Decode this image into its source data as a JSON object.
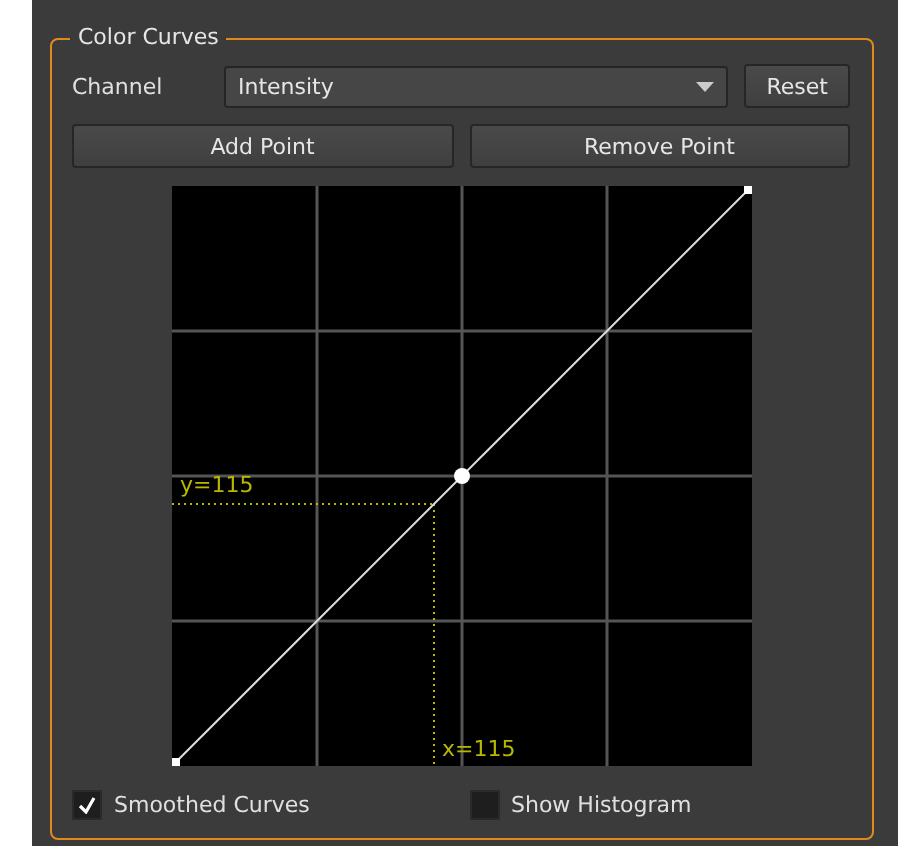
{
  "group": {
    "title": "Color Curves"
  },
  "channel": {
    "label": "Channel",
    "value": "Intensity"
  },
  "reset_button": "Reset",
  "buttons": [
    "Add Point",
    "Remove Point"
  ],
  "curve_editor": {
    "cursor_y_label": "y=115",
    "cursor_x_label": "x=115"
  },
  "checkboxes": [
    {
      "label": "Smoothed Curves",
      "checked": true
    },
    {
      "label": "Show Histogram",
      "checked": false
    }
  ]
}
